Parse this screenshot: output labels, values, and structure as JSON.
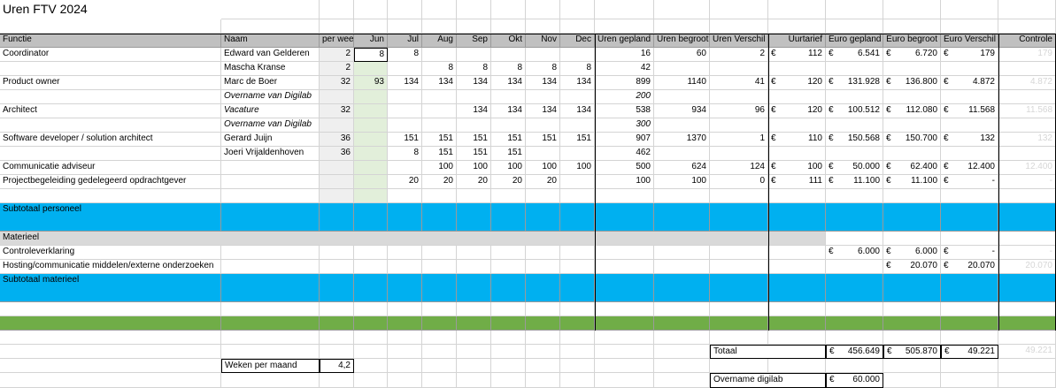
{
  "title": "Uren FTV 2024",
  "colors": {
    "header": "#c0c0c0",
    "subtotal_blue": "#00b0f0",
    "total_green": "#70ad47",
    "section_gray": "#d9d9d9",
    "juni_green": "#e2efda"
  },
  "header": {
    "functie": "Functie",
    "naam": "Naam",
    "per_week": "per week",
    "jun": "Jun",
    "jul": "Jul",
    "aug": "Aug",
    "sep": "Sep",
    "okt": "Okt",
    "nov": "Nov",
    "dec": "Dec",
    "uren_gepland": "Uren gepland",
    "uren_begroot": "Uren begroot",
    "uren_verschil": "Uren Verschil",
    "uurtarief": "Uurtarief",
    "euro_gepland": "Euro gepland",
    "euro_begroot": "Euro begroot",
    "euro_verschil": "Euro Verschil",
    "controle": "Controle"
  },
  "currency": "€",
  "rows": [
    {
      "functie": "Coordinator",
      "naam": "Edward van Gelderen",
      "per_week": "2",
      "jun": "8",
      "jul": "8",
      "aug": "",
      "sep": "",
      "okt": "",
      "nov": "",
      "dec": "",
      "uren_gepland": "16",
      "uren_begroot": "60",
      "uren_verschil": "2",
      "uurtarief": "112",
      "euro_gepland": "6.541",
      "euro_begroot": "6.720",
      "euro_verschil": "179",
      "controle": "179"
    },
    {
      "functie": "",
      "naam": "Mascha Kranse",
      "per_week": "2",
      "jun": "",
      "jul": "",
      "aug": "8",
      "sep": "8",
      "okt": "8",
      "nov": "8",
      "dec": "8",
      "uren_gepland": "42",
      "uren_begroot": "",
      "uren_verschil": "",
      "uurtarief": "",
      "euro_gepland": "",
      "euro_begroot": "",
      "euro_verschil": "",
      "controle": ""
    },
    {
      "functie": "Product owner",
      "naam": "Marc de Boer",
      "per_week": "32",
      "jun": "93",
      "jul": "134",
      "aug": "134",
      "sep": "134",
      "okt": "134",
      "nov": "134",
      "dec": "134",
      "uren_gepland": "899",
      "uren_begroot": "1140",
      "uren_verschil": "41",
      "uurtarief": "120",
      "euro_gepland": "131.928",
      "euro_begroot": "136.800",
      "euro_verschil": "4.872",
      "controle": "4.872"
    },
    {
      "functie": "",
      "naam": "Overname van Digilab",
      "naam_italic": true,
      "per_week": "",
      "jun": "",
      "jul": "",
      "aug": "",
      "sep": "",
      "okt": "",
      "nov": "",
      "dec": "",
      "uren_gepland": "200",
      "uren_gepland_italic": true,
      "uren_begroot": "",
      "uren_verschil": "",
      "uurtarief": "",
      "euro_gepland": "",
      "euro_begroot": "",
      "euro_verschil": "",
      "controle": ""
    },
    {
      "functie": "Architect",
      "naam": "Vacature",
      "naam_italic": true,
      "per_week": "32",
      "jun": "",
      "jul": "",
      "aug": "",
      "sep": "134",
      "okt": "134",
      "nov": "134",
      "dec": "134",
      "uren_gepland": "538",
      "uren_begroot": "934",
      "uren_verschil": "96",
      "uurtarief": "120",
      "euro_gepland": "100.512",
      "euro_begroot": "112.080",
      "euro_verschil": "11.568",
      "controle": "11.568"
    },
    {
      "functie": "",
      "naam": "Overname van Digilab",
      "naam_italic": true,
      "per_week": "",
      "jun": "",
      "jul": "",
      "aug": "",
      "sep": "",
      "okt": "",
      "nov": "",
      "dec": "",
      "uren_gepland": "300",
      "uren_gepland_italic": true,
      "uren_begroot": "",
      "uren_verschil": "",
      "uurtarief": "",
      "euro_gepland": "",
      "euro_begroot": "",
      "euro_verschil": "",
      "controle": ""
    },
    {
      "functie": "Software developer / solution architect",
      "naam": "Gerard Juijn",
      "per_week": "36",
      "jun": "",
      "jul": "151",
      "aug": "151",
      "sep": "151",
      "okt": "151",
      "nov": "151",
      "dec": "151",
      "uren_gepland": "907",
      "uren_begroot": "1370",
      "uren_verschil": "1",
      "uurtarief": "110",
      "euro_gepland": "150.568",
      "euro_begroot": "150.700",
      "euro_verschil": "132",
      "controle": "132"
    },
    {
      "functie": "",
      "naam": "Joeri Vrijaldenhoven",
      "per_week": "36",
      "jun": "",
      "jul": "8",
      "aug": "151",
      "sep": "151",
      "okt": "151",
      "nov": "",
      "dec": "",
      "uren_gepland": "462",
      "uren_begroot": "",
      "uren_verschil": "",
      "uurtarief": "",
      "euro_gepland": "",
      "euro_begroot": "",
      "euro_verschil": "",
      "controle": ""
    },
    {
      "functie": "Communicatie adviseur",
      "naam": "",
      "per_week": "",
      "jun": "",
      "jul": "",
      "aug": "100",
      "sep": "100",
      "okt": "100",
      "nov": "100",
      "dec": "100",
      "uren_gepland": "500",
      "uren_begroot": "624",
      "uren_verschil": "124",
      "uurtarief": "100",
      "euro_gepland": "50.000",
      "euro_begroot": "62.400",
      "euro_verschil": "12.400",
      "controle": "12.400"
    },
    {
      "functie": "Projectbegeleiding gedelegeerd opdrachtgever",
      "naam": "",
      "per_week": "",
      "jun": "",
      "jul": "20",
      "aug": "20",
      "sep": "20",
      "okt": "20",
      "nov": "20",
      "dec": "",
      "uren_gepland": "100",
      "uren_begroot": "100",
      "uren_verschil": "0",
      "uurtarief": "111",
      "euro_gepland": "11.100",
      "euro_begroot": "11.100",
      "euro_verschil": "-",
      "controle": "-"
    }
  ],
  "subtotaal_personeel": "Subtotaal personeel",
  "materieel": "Materieel",
  "materieel_rows": [
    {
      "functie": "Controleverklaring",
      "euro_gepland": "6.000",
      "euro_begroot": "6.000",
      "euro_verschil": "-",
      "controle": "-"
    },
    {
      "functie": "Hosting/communicatie middelen/externe onderzoeken",
      "euro_gepland": "",
      "euro_begroot": "20.070",
      "euro_verschil": "20.070",
      "controle": "20.070"
    }
  ],
  "subtotaal_materieel": "Subtotaal materieel",
  "totaal": {
    "label": "Totaal",
    "euro_gepland": "456.649",
    "euro_begroot": "505.870",
    "euro_verschil": "49.221",
    "controle": "49.221"
  },
  "weken_per_maand": {
    "label": "Weken per maand",
    "value": "4,2"
  },
  "overname_digilab": {
    "label": "Overname digilab",
    "value": "60.000"
  }
}
